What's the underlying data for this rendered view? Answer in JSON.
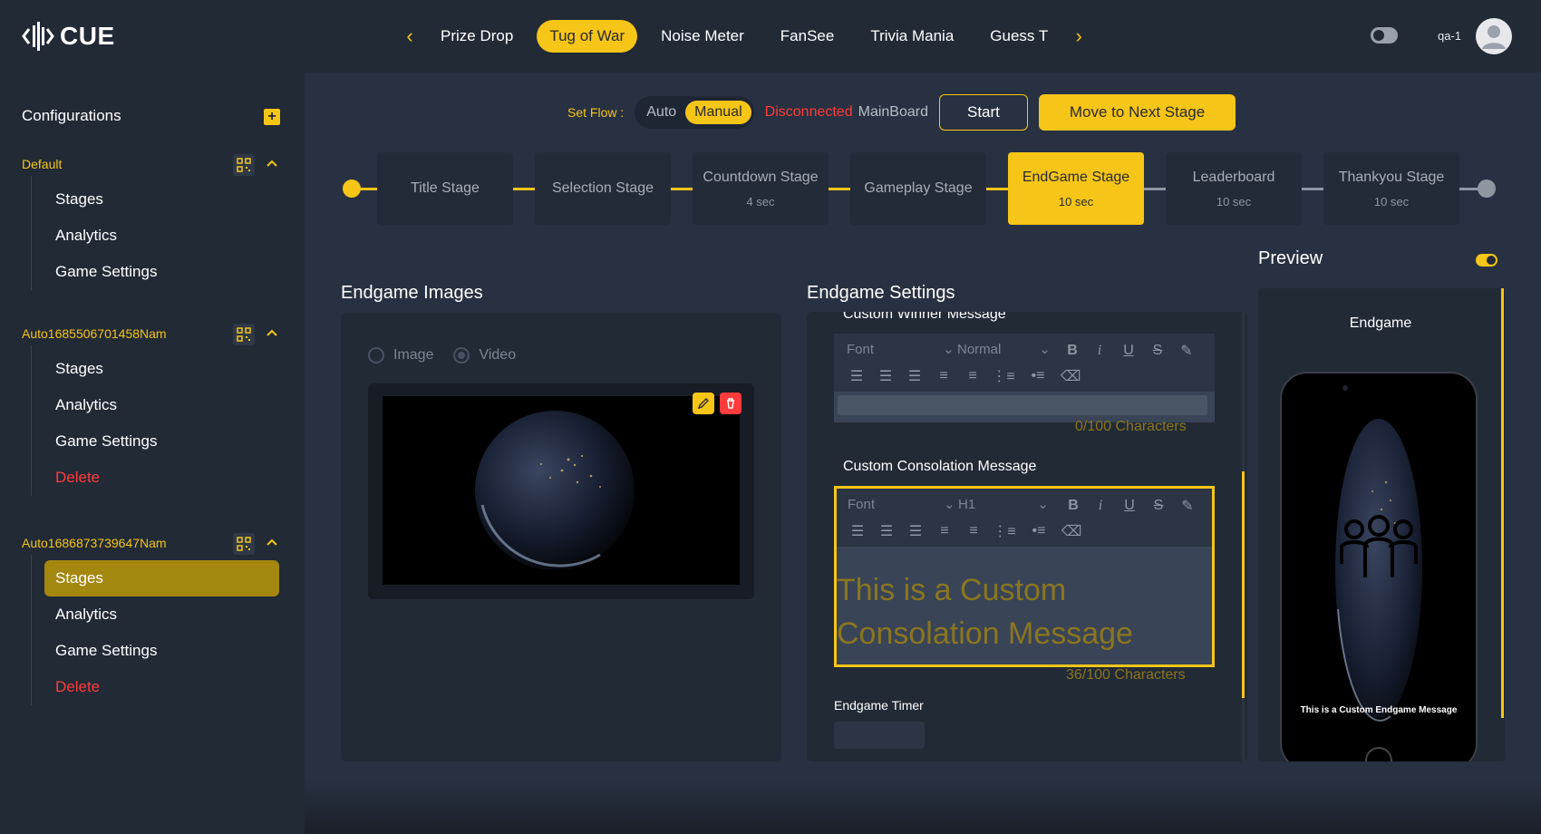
{
  "app": {
    "logo_text": "CUE",
    "user": "qa-1"
  },
  "game_tabs": [
    "Prize Drop",
    "Tug of War",
    "Noise Meter",
    "FanSee",
    "Trivia Mania",
    "Guess T"
  ],
  "active_tab": "Tug of War",
  "sidebar": {
    "header": "Configurations",
    "groups": [
      {
        "title": "Default",
        "items": [
          "Stages",
          "Analytics",
          "Game Settings"
        ]
      },
      {
        "title": "Auto1685506701458Nam",
        "items": [
          "Stages",
          "Analytics",
          "Game Settings",
          "Delete"
        ]
      },
      {
        "title": "Auto1686873739647Nam",
        "items": [
          "Stages",
          "Analytics",
          "Game Settings",
          "Delete"
        ]
      }
    ]
  },
  "flow": {
    "label": "Set Flow :",
    "options": [
      "Auto",
      "Manual"
    ],
    "selected": "Manual",
    "status": "Disconnected",
    "board": "MainBoard",
    "start_button": "Start",
    "next_button": "Move to Next Stage"
  },
  "stages": [
    {
      "name": "Title Stage",
      "duration": ""
    },
    {
      "name": "Selection Stage",
      "duration": ""
    },
    {
      "name": "Countdown Stage",
      "duration": "4 sec"
    },
    {
      "name": "Gameplay Stage",
      "duration": ""
    },
    {
      "name": "EndGame Stage",
      "duration": "10 sec",
      "active": true
    },
    {
      "name": "Leaderboard",
      "duration": "10 sec"
    },
    {
      "name": "Thankyou Stage",
      "duration": "10 sec"
    }
  ],
  "images": {
    "title": "Endgame Images",
    "radio_image": "Image",
    "radio_video": "Video",
    "selected": "Video"
  },
  "settings": {
    "title": "Endgame Settings",
    "winner_label": "Custom Winner Message",
    "winner_font": "Font",
    "winner_size": "Normal",
    "winner_counter": "0/100 Characters",
    "consolation_label": "Custom Consolation Message",
    "consolation_font": "Font",
    "consolation_size": "H1",
    "consolation_text": "This is a Custom Consolation Message",
    "consolation_counter": "36/100 Characters",
    "timer_label": "Endgame Timer"
  },
  "preview": {
    "title": "Preview",
    "screen_name": "Endgame",
    "message": "This is a Custom Endgame Message"
  },
  "colors": {
    "accent": "#f5c518",
    "danger": "#ff3b3b",
    "bg": "#283141",
    "panel": "#222a36"
  }
}
